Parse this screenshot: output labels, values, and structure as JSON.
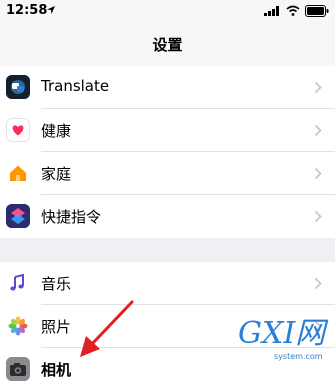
{
  "status_bar": {
    "time": "12:58",
    "icons": [
      "location-arrow-icon",
      "signal-icon",
      "wifi-icon",
      "battery-icon"
    ]
  },
  "nav": {
    "title": "设置"
  },
  "groups": [
    {
      "items": [
        {
          "label": "Translate",
          "icon": "translate-icon"
        },
        {
          "label": "健康",
          "icon": "health-heart-icon"
        },
        {
          "label": "家庭",
          "icon": "home-icon"
        },
        {
          "label": "快捷指令",
          "icon": "shortcuts-icon"
        }
      ]
    },
    {
      "items": [
        {
          "label": "音乐",
          "icon": "music-note-icon"
        },
        {
          "label": "照片",
          "icon": "photos-flower-icon"
        },
        {
          "label": "相机",
          "icon": "camera-icon"
        }
      ]
    }
  ],
  "annotation": {
    "arrow_color": "#e02020",
    "points_to": "相机"
  },
  "watermark": {
    "big": "GXI网",
    "small": "system.com"
  },
  "colors": {
    "background": "#efeff4",
    "bar": "#f7f7f7",
    "health": "#ff2d55",
    "home": "#ff9500",
    "watermark": "#2a7fd6"
  }
}
